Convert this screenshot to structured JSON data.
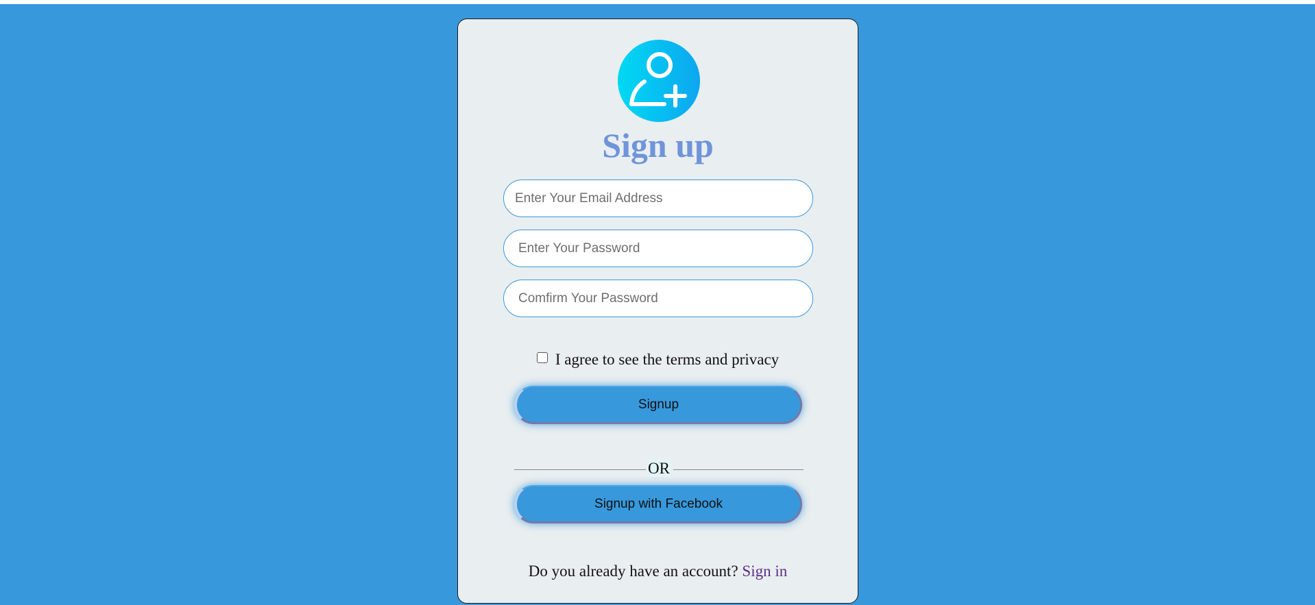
{
  "colors": {
    "page_background": "#3898dc",
    "card_background": "#e9eef0",
    "title": "#6f94da",
    "button": "#3898dc",
    "link": "#5b2d86",
    "avatar_gradient_start": "#00d9f3",
    "avatar_gradient_end": "#0da6f0"
  },
  "header": {
    "icon": "user-plus-icon",
    "title": "Sign up"
  },
  "form": {
    "email_placeholder": "Enter Your Email Address",
    "password_placeholder": "Enter Your Password",
    "confirm_placeholder": "Comfirm Your Password",
    "agree_label": "I agree to see the terms and privacy",
    "agree_checked": false,
    "signup_label": "Signup",
    "divider_label": "OR",
    "facebook_label": "Signup with Facebook"
  },
  "footer": {
    "prompt": "Do you already have an account?",
    "signin_label": "Sign in"
  }
}
